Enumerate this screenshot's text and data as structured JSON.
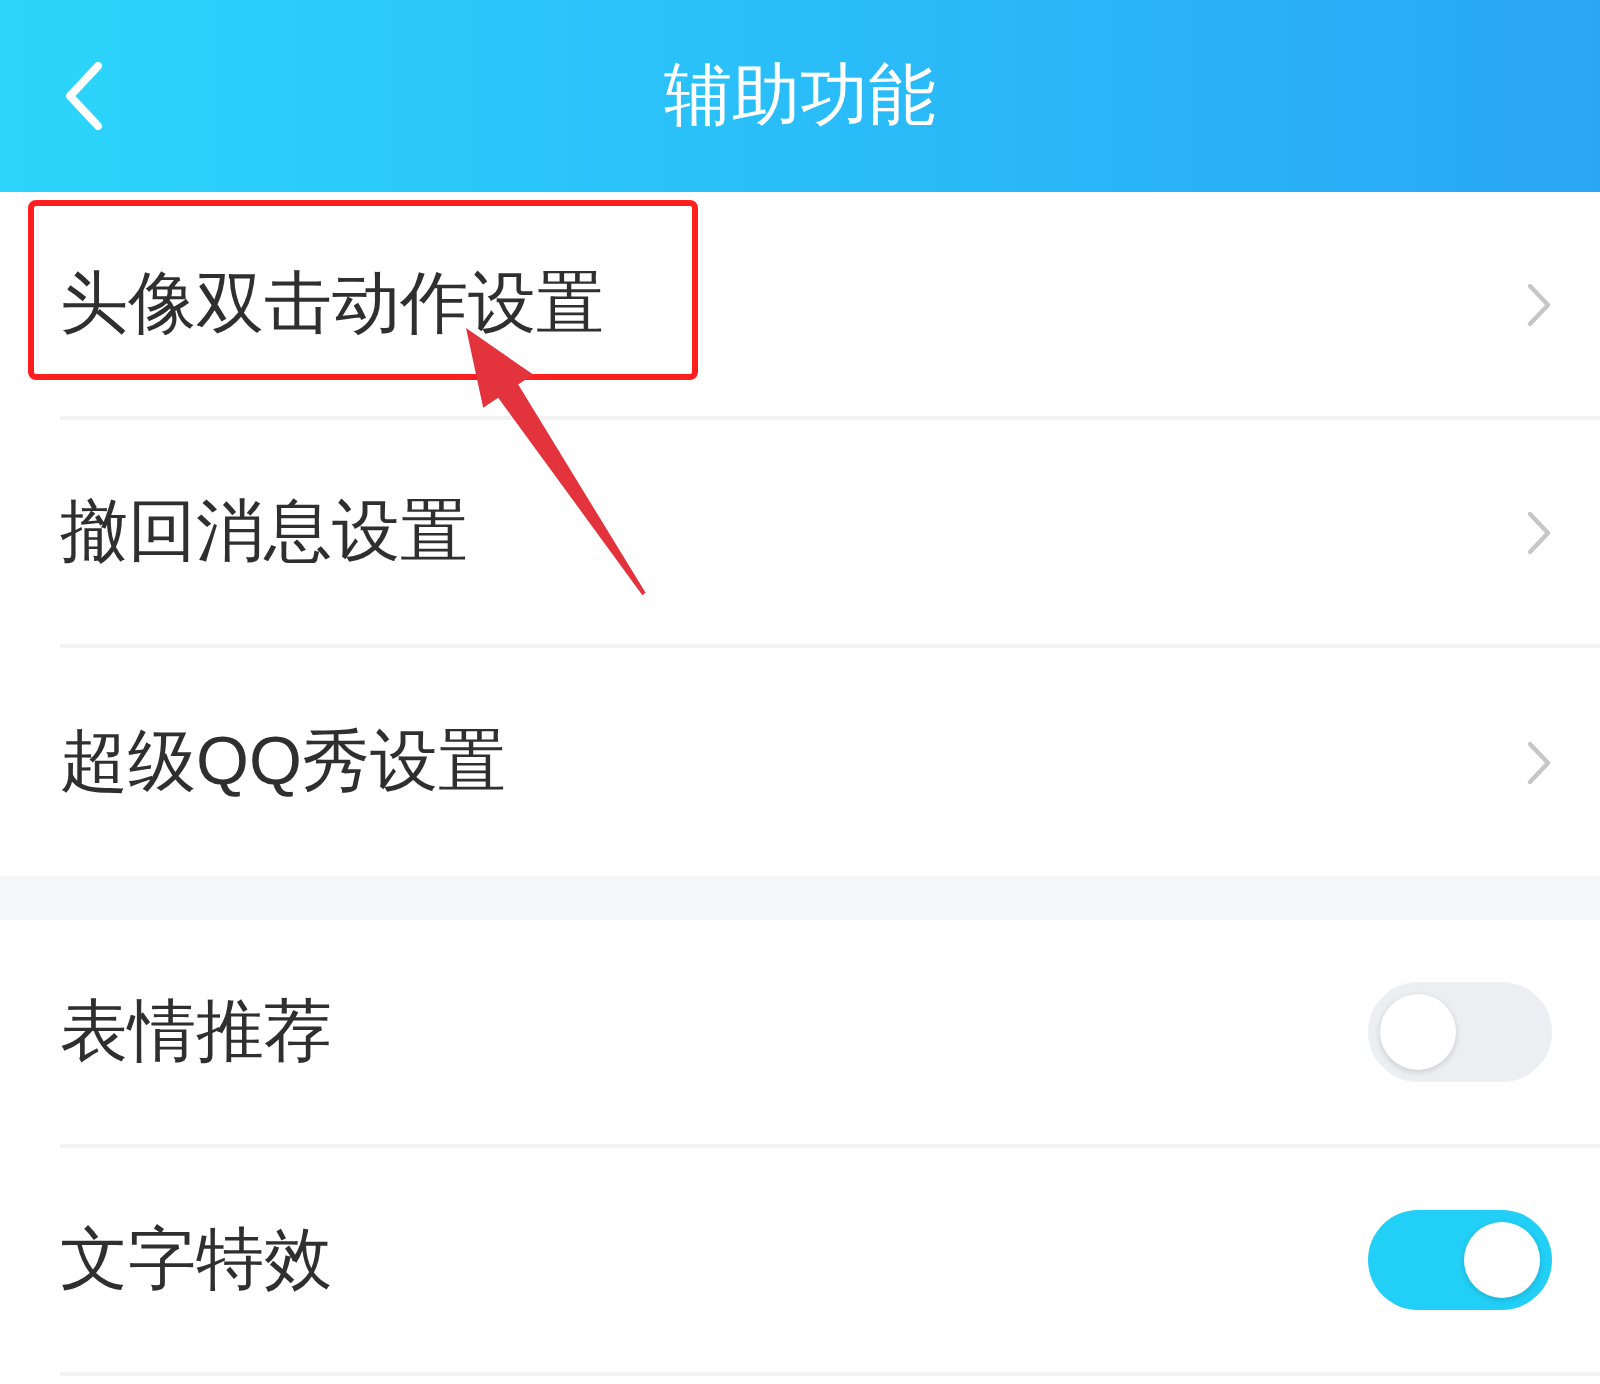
{
  "header": {
    "title": "辅助功能"
  },
  "sections": [
    {
      "items": [
        {
          "kind": "link",
          "label": "头像双击动作设置",
          "highlighted": true
        },
        {
          "kind": "link",
          "label": "撤回消息设置",
          "highlighted": false
        },
        {
          "kind": "link",
          "label": "超级QQ秀设置",
          "highlighted": false
        }
      ]
    },
    {
      "items": [
        {
          "kind": "toggle",
          "label": "表情推荐",
          "on": false
        },
        {
          "kind": "toggle",
          "label": "文字特效",
          "on": true
        }
      ]
    }
  ]
}
